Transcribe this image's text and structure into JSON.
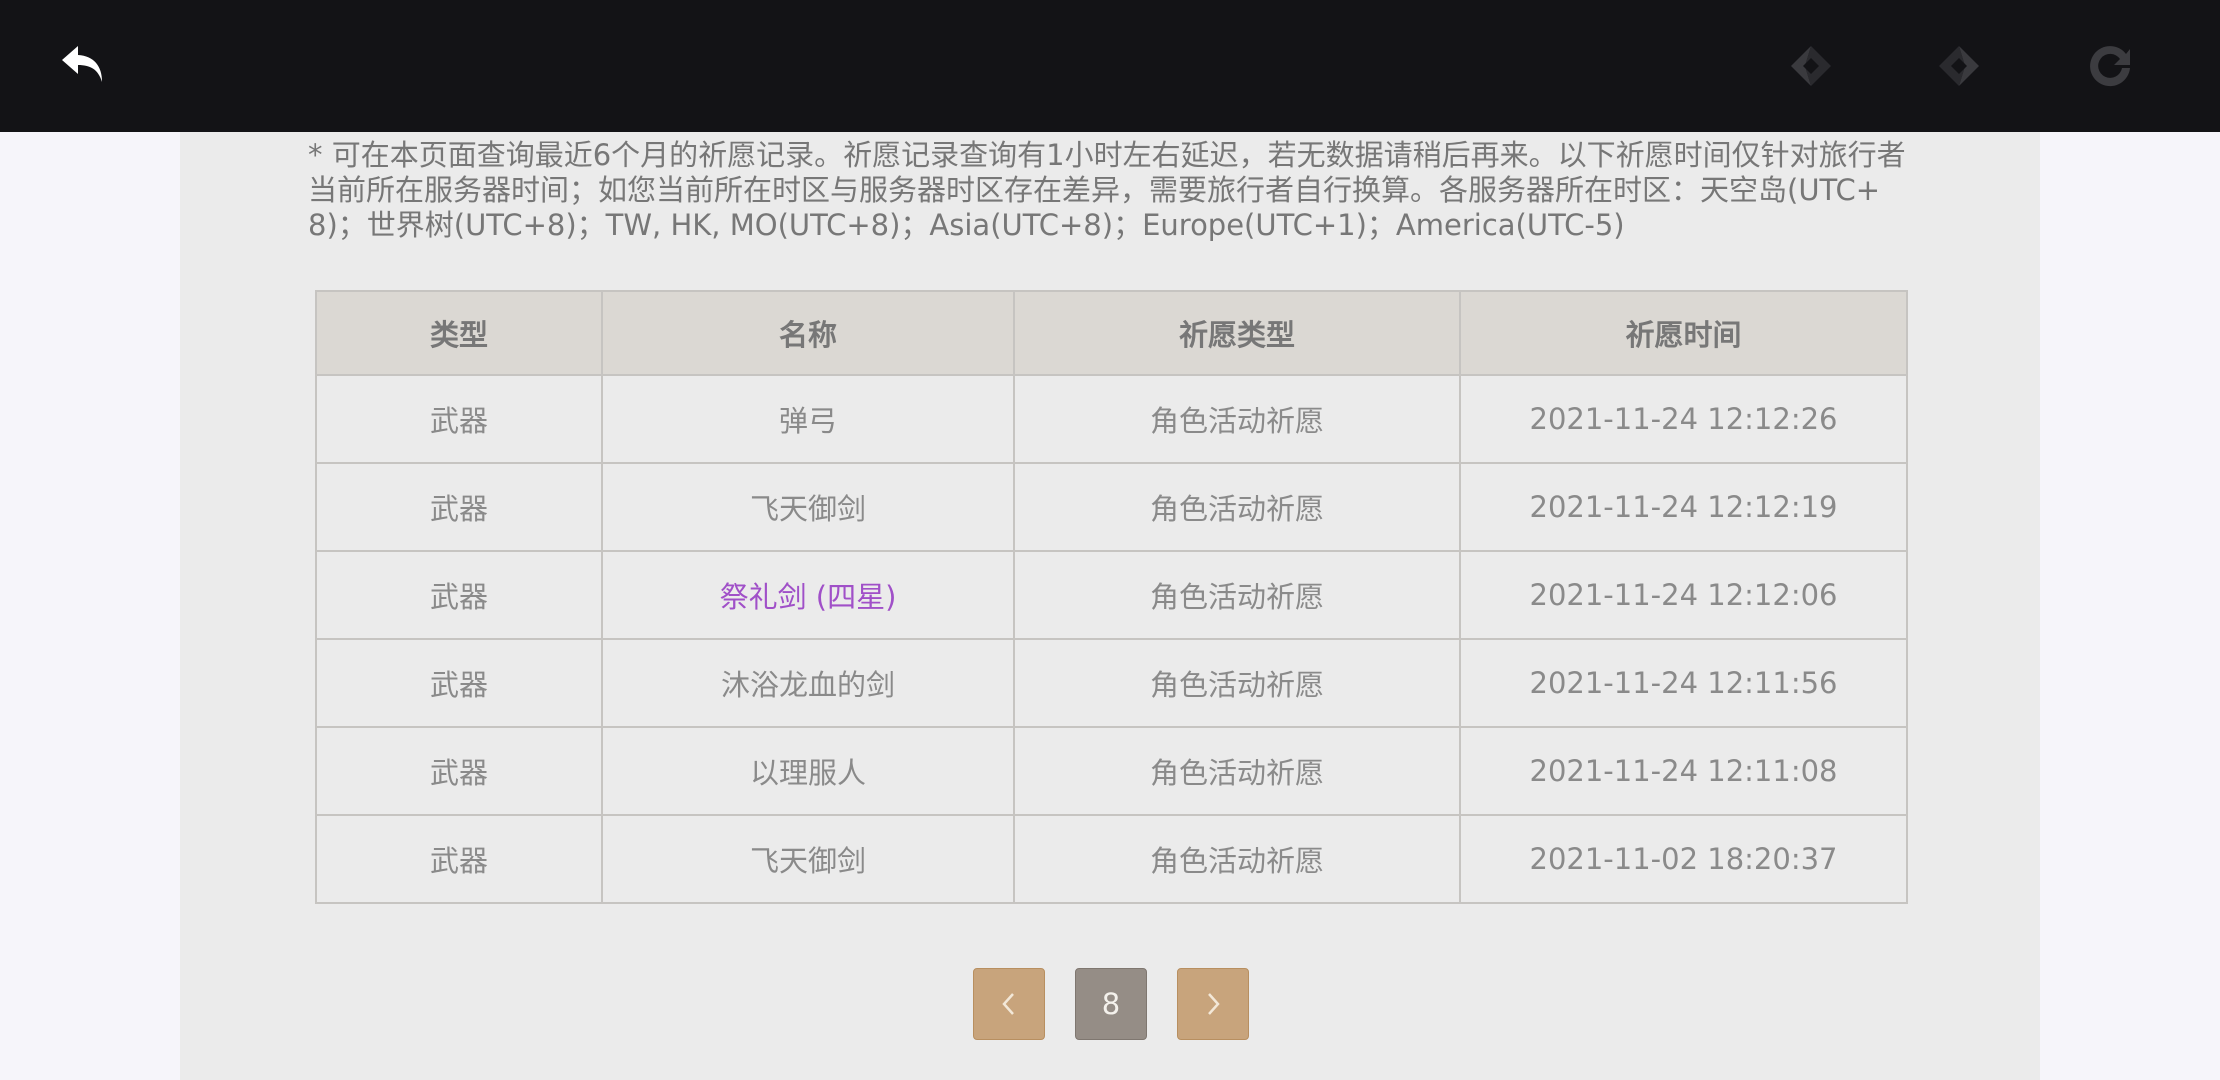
{
  "topbar": {
    "back_icon": "back-arrow-icon",
    "nav_back_icon": "nav-back-icon",
    "nav_forward_icon": "nav-forward-icon",
    "refresh_icon": "refresh-icon",
    "background": "#131316"
  },
  "notice": "* 可在本页面查询最近6个月的祈愿记录。祈愿记录查询有1小时左右延迟，若无数据请稍后再来。以下祈愿时间仅针对旅行者当前所在服务器时间；如您当前所在时区与服务器时区存在差异，需要旅行者自行换算。各服务器所在时区：天空岛(UTC+8)；世界树(UTC+8)；TW, HK, MO(UTC+8)；Asia(UTC+8)；Europe(UTC+1)；America(UTC-5)",
  "table": {
    "headers": [
      "类型",
      "名称",
      "祈愿类型",
      "祈愿时间"
    ],
    "rows": [
      [
        "武器",
        "弹弓",
        "角色活动祈愿",
        "2021-11-24 12:12:26"
      ],
      [
        "武器",
        "飞天御剑",
        "角色活动祈愿",
        "2021-11-24 12:12:19"
      ],
      [
        "武器",
        "祭礼剑 (四星)",
        "角色活动祈愿",
        "2021-11-24 12:12:06"
      ],
      [
        "武器",
        "沐浴龙血的剑",
        "角色活动祈愿",
        "2021-11-24 12:11:56"
      ],
      [
        "武器",
        "以理服人",
        "角色活动祈愿",
        "2021-11-24 12:11:08"
      ],
      [
        "武器",
        "飞天御剑",
        "角色活动祈愿",
        "2021-11-02 18:20:37"
      ]
    ],
    "four_star_color": "#a050c8"
  },
  "pagination": {
    "prev_icon": "chevron-left-icon",
    "current_page": "8",
    "next_icon": "chevron-right-icon",
    "button_color": "#c8a47c",
    "current_color": "#958d86"
  }
}
